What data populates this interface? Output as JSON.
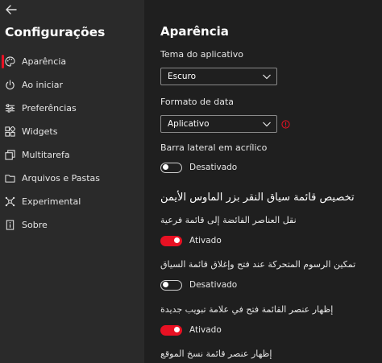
{
  "sidebar": {
    "back_icon": "back-arrow-icon",
    "title": "Configurações",
    "items": [
      {
        "label": "Aparência",
        "icon": "palette-icon",
        "active": true
      },
      {
        "label": "Ao iniciar",
        "icon": "power-icon",
        "active": false
      },
      {
        "label": "Preferências",
        "icon": "sliders-icon",
        "active": false
      },
      {
        "label": "Widgets",
        "icon": "widgets-grid-icon",
        "active": false
      },
      {
        "label": "Multitarefa",
        "icon": "multitask-icon",
        "active": false
      },
      {
        "label": "Arquivos e Pastas",
        "icon": "folder-icon",
        "active": false
      },
      {
        "label": "Experimental",
        "icon": "experimental-icon",
        "active": false
      },
      {
        "label": "Sobre",
        "icon": "info-card-icon",
        "active": false
      }
    ]
  },
  "main": {
    "title": "Aparência",
    "app_theme": {
      "label": "Tema do aplicativo",
      "value": "Escuro"
    },
    "date_format": {
      "label": "Formato de data",
      "value": "Aplicativo",
      "warning_icon": "warning-info-icon"
    },
    "acrylic_sidebar": {
      "label": "Barra lateral em acrílico",
      "state": "Desativado",
      "on": false
    },
    "context_menu_section": {
      "title": "تخصيص قائمة سياق النقر بزر الماوس الأيمن",
      "options": [
        {
          "label": "نقل العناصر الفائضة إلى قائمة فرعية",
          "state": "Ativado",
          "on": true
        },
        {
          "label": "تمكين الرسوم المتحركة عند فتح وإغلاق قائمة السياق",
          "state": "Desativado",
          "on": false
        },
        {
          "label": "إظهار عنصر القائمة فتح في علامة تبويب جديدة",
          "state": "Ativado",
          "on": true
        },
        {
          "label": "إظهار عنصر قائمة نسخ الموقع",
          "state": "",
          "on": false
        }
      ]
    }
  },
  "colors": {
    "accent": "#e81123",
    "sidebar_bg": "#2a2a2a",
    "content_bg": "#1f1f1f"
  }
}
